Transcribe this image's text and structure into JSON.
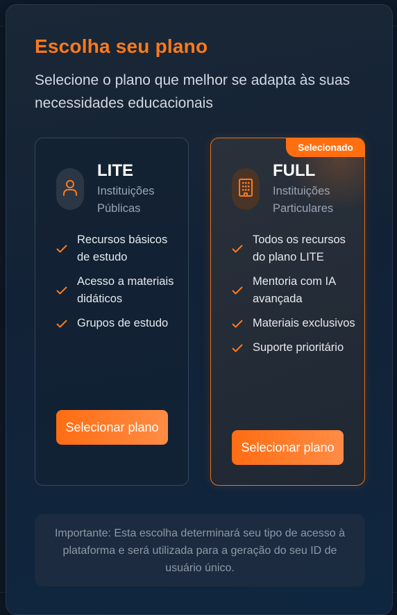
{
  "header": {
    "title": "Escolha seu plano",
    "subtitle": "Selecione o plano que melhor se adapta às suas necessidades educacionais"
  },
  "plans": [
    {
      "name": "LITE",
      "description": "Instituições Públicas",
      "icon": "user-icon",
      "features": [
        "Recursos básicos de estudo",
        "Acesso a materiais didáticos",
        "Grupos de estudo"
      ],
      "button_label": "Selecionar plano",
      "selected": false
    },
    {
      "name": "FULL",
      "description": "Instituições Particulares",
      "icon": "building-icon",
      "features": [
        "Todos os recursos do plano LITE",
        "Mentoria com IA avançada",
        "Materiais exclusivos",
        "Suporte prioritário"
      ],
      "button_label": "Selecionar plano",
      "selected": true,
      "badge": "Selecionado"
    }
  ],
  "note": "Importante: Esta escolha determinará seu tipo de acesso à plataforma e será utilizada para a geração do seu ID de usuário único.",
  "colors": {
    "accent": "#ff7a1a",
    "background": "#122236"
  }
}
